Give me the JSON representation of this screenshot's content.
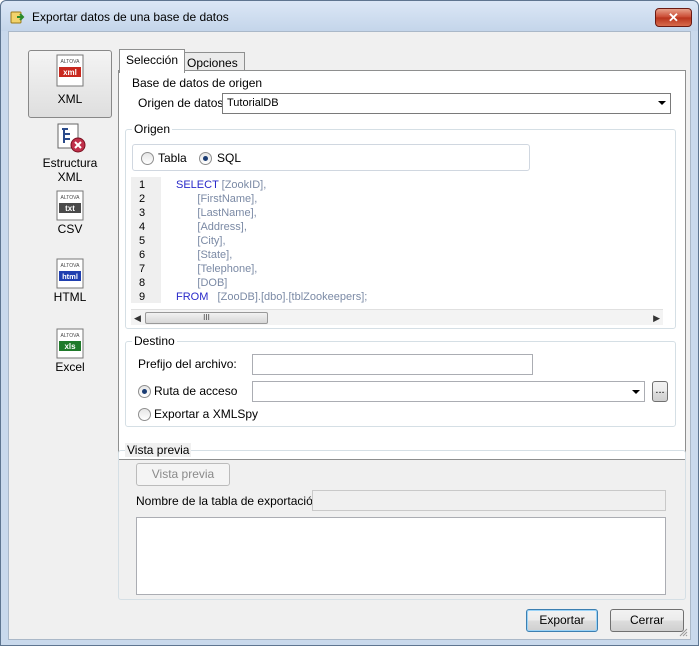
{
  "window": {
    "title": "Exportar datos de una base de datos",
    "close_glyph": "✕"
  },
  "formats": [
    {
      "label": "XML",
      "badge": "xml",
      "selected": true
    },
    {
      "label": "Estructura XML",
      "badge": "",
      "selected": false
    },
    {
      "label": "CSV",
      "badge": "txt",
      "selected": false
    },
    {
      "label": "HTML",
      "badge": "html",
      "selected": false
    },
    {
      "label": "Excel",
      "badge": "xls",
      "selected": false
    }
  ],
  "icon_brand": "ALTOVA",
  "tabs": [
    {
      "label": "Selección",
      "active": true
    },
    {
      "label": "Opciones",
      "active": false
    }
  ],
  "source_db": {
    "group_title": "Base de datos de origen",
    "label": "Origen de datos:",
    "value": "TutorialDB"
  },
  "origin": {
    "group_title": "Origen",
    "options": [
      {
        "label": "Tabla",
        "checked": false
      },
      {
        "label": "SQL",
        "checked": true
      }
    ]
  },
  "sql": {
    "line_numbers": [
      "1",
      "2",
      "3",
      "4",
      "5",
      "6",
      "7",
      "8",
      "9"
    ],
    "lines": [
      {
        "kw": "SELECT",
        "rest": " [ZookID],"
      },
      {
        "kw": "",
        "rest": "       [FirstName],"
      },
      {
        "kw": "",
        "rest": "       [LastName],"
      },
      {
        "kw": "",
        "rest": "       [Address],"
      },
      {
        "kw": "",
        "rest": "       [City],"
      },
      {
        "kw": "",
        "rest": "       [State],"
      },
      {
        "kw": "",
        "rest": "       [Telephone],"
      },
      {
        "kw": "",
        "rest": "       [DOB]"
      },
      {
        "kw": "FROM",
        "rest": "   [ZooDB].[dbo].[tblZookeepers];"
      }
    ],
    "scroll_grip": "III"
  },
  "destination": {
    "group_title": "Destino",
    "prefix_label": "Prefijo del archivo:",
    "prefix_value": "",
    "path_label": "Ruta de acceso",
    "path_value": "",
    "path_checked": true,
    "browse_label": "...",
    "xmlspy_label": "Exportar a XMLSpy",
    "xmlspy_checked": false
  },
  "preview": {
    "group_title": "Vista previa",
    "button_label": "Vista previa",
    "table_name_label": "Nombre de la tabla de exportación:",
    "table_name_value": ""
  },
  "actions": {
    "export_label": "Exportar",
    "close_label": "Cerrar"
  }
}
